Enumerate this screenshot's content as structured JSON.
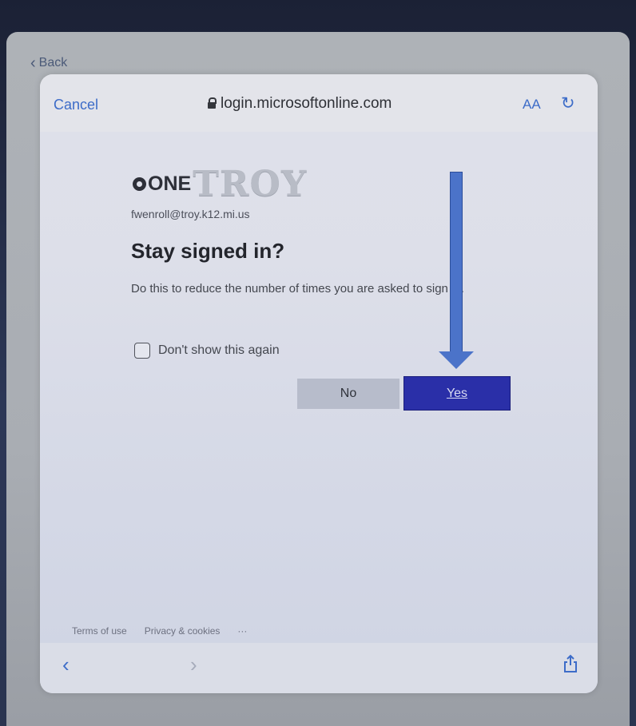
{
  "back": {
    "label": "Back"
  },
  "browser": {
    "cancel": "Cancel",
    "url": "login.microsoftonline.com",
    "text_size": "AA"
  },
  "login": {
    "logo_one": "ONE",
    "logo_troy": "TROY",
    "email": "fwenroll@troy.k12.mi.us",
    "title": "Stay signed in?",
    "description": "Do this to reduce the number of times you are asked to sign in.",
    "checkbox_label": "Don't show this again",
    "checkbox_checked": false,
    "no_label": "No",
    "yes_label": "Yes"
  },
  "footer": {
    "terms": "Terms of use",
    "privacy": "Privacy & cookies",
    "more": "···"
  },
  "colors": {
    "accent": "#3d6cc8",
    "primary_button": "#2a2fa8",
    "annotation_arrow": "#4b73c9"
  }
}
